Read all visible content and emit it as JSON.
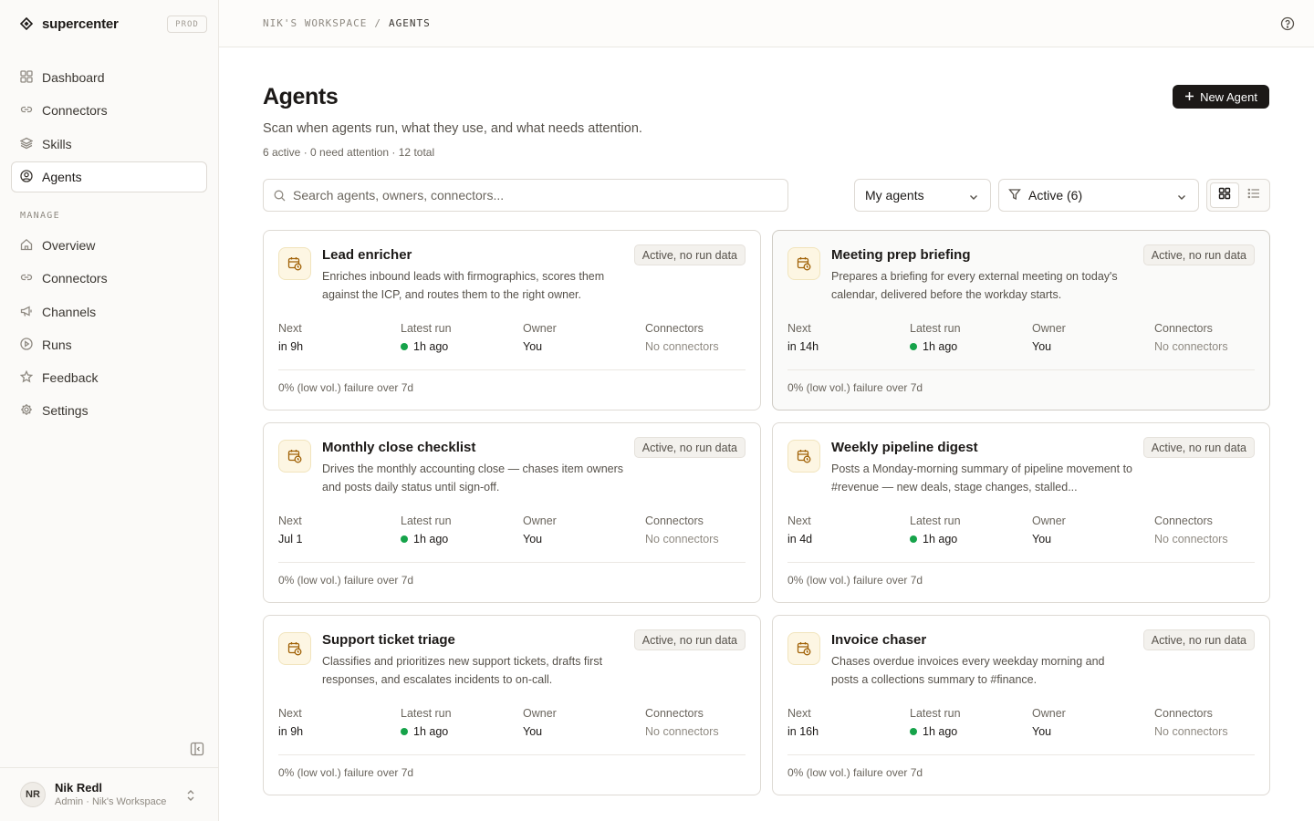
{
  "app": {
    "name": "supercenter",
    "env": "PROD"
  },
  "nav": {
    "primary": [
      {
        "label": "Dashboard",
        "icon": "grid-icon",
        "active": false
      },
      {
        "label": "Connectors",
        "icon": "link-icon",
        "active": false
      },
      {
        "label": "Skills",
        "icon": "layers-icon",
        "active": false
      },
      {
        "label": "Agents",
        "icon": "user-circle-icon",
        "active": true
      }
    ],
    "section_label": "MANAGE",
    "manage": [
      {
        "label": "Overview",
        "icon": "home-icon"
      },
      {
        "label": "Connectors",
        "icon": "link-icon"
      },
      {
        "label": "Channels",
        "icon": "megaphone-icon"
      },
      {
        "label": "Runs",
        "icon": "play-circle-icon"
      },
      {
        "label": "Feedback",
        "icon": "star-icon"
      },
      {
        "label": "Settings",
        "icon": "gear-icon"
      }
    ]
  },
  "user": {
    "initials": "NR",
    "name": "Nik Redl",
    "meta": "Admin · Nik's Workspace"
  },
  "breadcrumb": {
    "workspace": "NIK'S WORKSPACE",
    "separator": "/",
    "current": "AGENTS"
  },
  "page": {
    "title": "Agents",
    "subtitle": "Scan when agents run, what they use, and what needs attention.",
    "stats": "6 active · 0 need attention · 12 total",
    "new_button": "New Agent"
  },
  "filters": {
    "search_placeholder": "Search agents, owners, connectors...",
    "owner_select": "My agents",
    "status_select": "Active (6)",
    "view": "grid"
  },
  "labels": {
    "next": "Next",
    "latest_run": "Latest run",
    "owner": "Owner",
    "connectors": "Connectors"
  },
  "colors": {
    "accent": "#1c1917",
    "run_ok": "#16a34a",
    "icon_bg": "#fdf6e3",
    "icon_fg": "#a16207"
  },
  "agents": [
    {
      "name": "Lead enricher",
      "status": "Active, no run data",
      "description": "Enriches inbound leads with firmographics, scores them against the ICP, and routes them to the right owner.",
      "next": "in 9h",
      "latest_run": "1h ago",
      "owner": "You",
      "connectors": "No connectors",
      "footer": "0% (low vol.) failure over 7d"
    },
    {
      "name": "Meeting prep briefing",
      "status": "Active, no run data",
      "description": "Prepares a briefing for every external meeting on today's calendar, delivered before the workday starts.",
      "next": "in 14h",
      "latest_run": "1h ago",
      "owner": "You",
      "connectors": "No connectors",
      "footer": "0% (low vol.) failure over 7d"
    },
    {
      "name": "Monthly close checklist",
      "status": "Active, no run data",
      "description": "Drives the monthly accounting close — chases item owners and posts daily status until sign-off.",
      "next": "Jul 1",
      "latest_run": "1h ago",
      "owner": "You",
      "connectors": "No connectors",
      "footer": "0% (low vol.) failure over 7d"
    },
    {
      "name": "Weekly pipeline digest",
      "status": "Active, no run data",
      "description": "Posts a Monday-morning summary of pipeline movement to #revenue — new deals, stage changes, stalled...",
      "next": "in 4d",
      "latest_run": "1h ago",
      "owner": "You",
      "connectors": "No connectors",
      "footer": "0% (low vol.) failure over 7d"
    },
    {
      "name": "Support ticket triage",
      "status": "Active, no run data",
      "description": "Classifies and prioritizes new support tickets, drafts first responses, and escalates incidents to on-call.",
      "next": "in 9h",
      "latest_run": "1h ago",
      "owner": "You",
      "connectors": "No connectors",
      "footer": "0% (low vol.) failure over 7d"
    },
    {
      "name": "Invoice chaser",
      "status": "Active, no run data",
      "description": "Chases overdue invoices every weekday morning and posts a collections summary to #finance.",
      "next": "in 16h",
      "latest_run": "1h ago",
      "owner": "You",
      "connectors": "No connectors",
      "footer": "0% (low vol.) failure over 7d"
    }
  ]
}
